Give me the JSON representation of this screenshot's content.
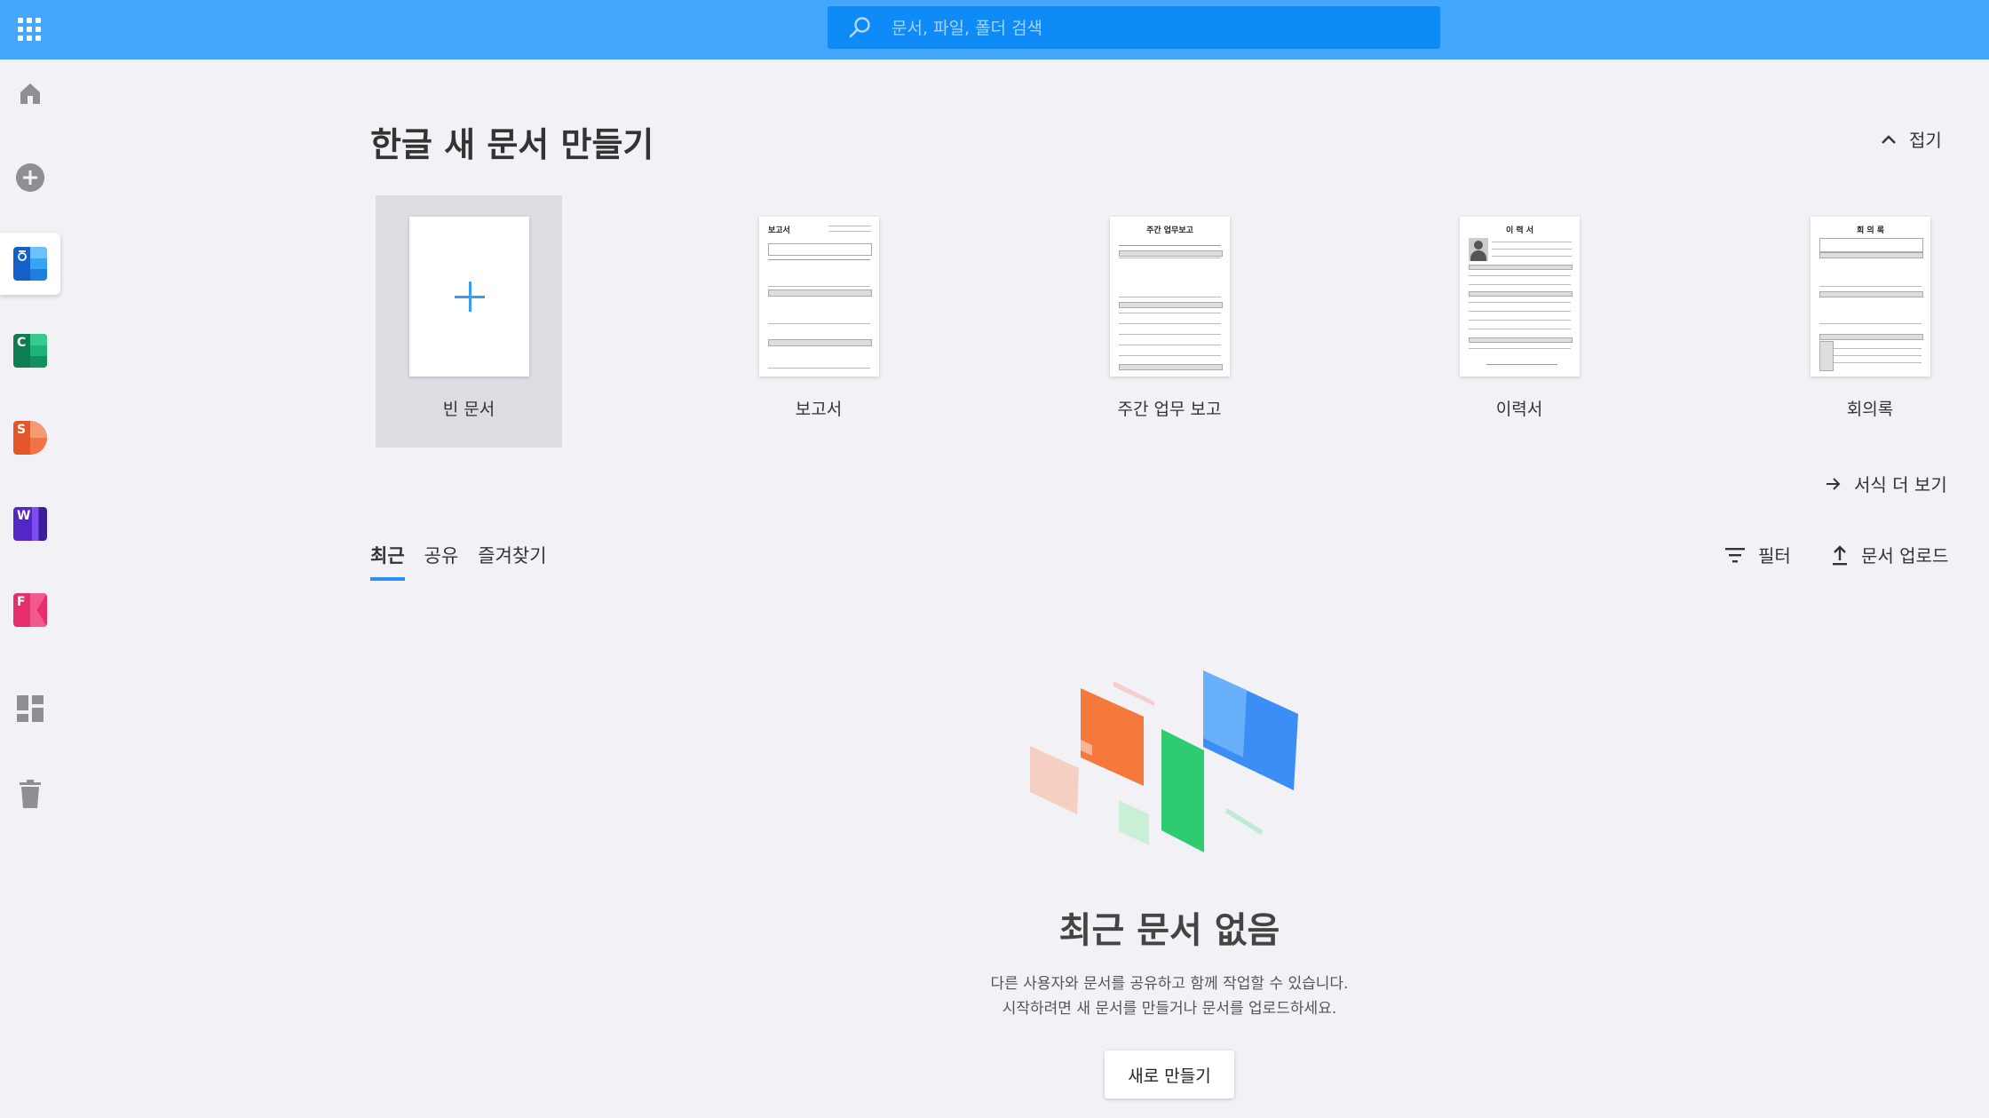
{
  "search": {
    "placeholder": "문서, 파일, 폴더 검색"
  },
  "sidebar": {
    "items": [
      {
        "name": "home",
        "icon": "home-icon"
      },
      {
        "name": "new",
        "icon": "plus-circle-icon"
      },
      {
        "name": "hangul",
        "letter": "",
        "color": "#1f7fe0",
        "active": true
      },
      {
        "name": "cell",
        "letter": "C",
        "color": "#18a06a"
      },
      {
        "name": "show",
        "letter": "S",
        "color": "#f0683a"
      },
      {
        "name": "word",
        "letter": "W",
        "color": "#6a3be0"
      },
      {
        "name": "form",
        "letter": "F",
        "color": "#ea3f7c"
      },
      {
        "name": "dashboard",
        "icon": "dashboard-icon"
      },
      {
        "name": "trash",
        "icon": "trash-icon"
      }
    ]
  },
  "header": {
    "title": "한글 새 문서 만들기",
    "collapse_label": "접기"
  },
  "templates": [
    {
      "label": "빈 문서",
      "type": "blank"
    },
    {
      "label": "보고서",
      "thumb_title": "보고서"
    },
    {
      "label": "주간 업무 보고",
      "thumb_title": "주간 업무보고"
    },
    {
      "label": "이력서",
      "thumb_title": "이 력 서"
    },
    {
      "label": "회의록",
      "thumb_title": "회 의 록"
    }
  ],
  "more_templates_label": "서식 더 보기",
  "tabs": [
    {
      "label": "최근",
      "active": true
    },
    {
      "label": "공유"
    },
    {
      "label": "즐겨찾기"
    }
  ],
  "actions": {
    "filter_label": "필터",
    "upload_label": "문서 업로드"
  },
  "empty_state": {
    "title": "최근 문서 없음",
    "line1": "다른 사용자와 문서를 공유하고 함께 작업할 수 있습니다.",
    "line2": "시작하려면 새 문서를 만들거나 문서를 업로드하세요.",
    "button_label": "새로 만들기"
  },
  "colors": {
    "accent": "#43a7fb",
    "search_bg": "#0e8bf6",
    "tab_underline": "#2c8ff0"
  }
}
